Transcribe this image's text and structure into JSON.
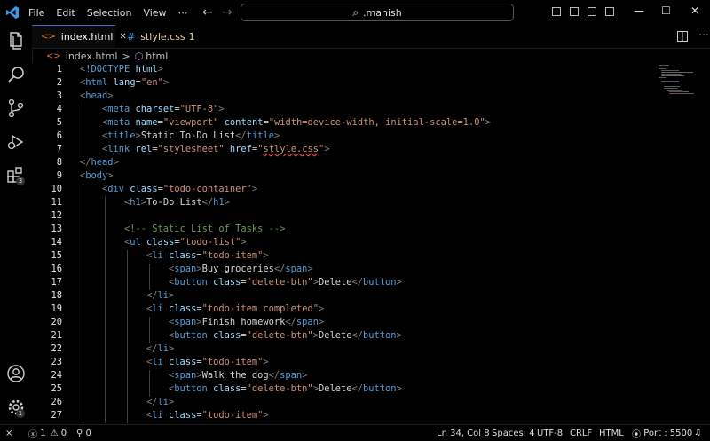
{
  "menu": [
    "File",
    "Edit",
    "Selection",
    "View",
    "⋯"
  ],
  "search": {
    "text": ".manish"
  },
  "window_controls": {
    "minimize": "—",
    "maximize": "☐",
    "close": "✕"
  },
  "activity_badges": {
    "extensions": "3",
    "settings": "1"
  },
  "tabs": [
    {
      "icon": "<>",
      "label": "index.html",
      "close": "✕",
      "active": true
    },
    {
      "icon": "#",
      "label": "stlyle.css",
      "count": "1",
      "active": false
    }
  ],
  "breadcrumb": {
    "file_icon": "<>",
    "file": "index.html",
    "sep": ">",
    "element_icon": "⬡",
    "element": "html"
  },
  "editor_lines": [
    {
      "n": "1",
      "indent": 0,
      "tokens": [
        [
          "p",
          "<"
        ],
        [
          "t",
          "!DOCTYPE "
        ],
        [
          "a",
          "html"
        ],
        [
          "p",
          ">"
        ]
      ]
    },
    {
      "n": "2",
      "indent": 0,
      "tokens": [
        [
          "p",
          "<"
        ],
        [
          "t",
          "html "
        ],
        [
          "a",
          "lang"
        ],
        [
          "x",
          "="
        ],
        [
          "s",
          "\"en\""
        ],
        [
          "p",
          ">"
        ]
      ]
    },
    {
      "n": "3",
      "indent": 0,
      "tokens": [
        [
          "p",
          "<"
        ],
        [
          "t",
          "head"
        ],
        [
          "p",
          ">"
        ]
      ]
    },
    {
      "n": "4",
      "indent": 1,
      "tokens": [
        [
          "p",
          "<"
        ],
        [
          "t",
          "meta "
        ],
        [
          "a",
          "charset"
        ],
        [
          "x",
          "="
        ],
        [
          "s",
          "\"UTF-8\""
        ],
        [
          "p",
          ">"
        ]
      ]
    },
    {
      "n": "5",
      "indent": 1,
      "tokens": [
        [
          "p",
          "<"
        ],
        [
          "t",
          "meta "
        ],
        [
          "a",
          "name"
        ],
        [
          "x",
          "="
        ],
        [
          "s",
          "\"viewport\" "
        ],
        [
          "a",
          "content"
        ],
        [
          "x",
          "="
        ],
        [
          "s",
          "\"width=device-width, initial-scale=1.0\""
        ],
        [
          "p",
          ">"
        ]
      ]
    },
    {
      "n": "6",
      "indent": 1,
      "tokens": [
        [
          "p",
          "<"
        ],
        [
          "t",
          "title"
        ],
        [
          "p",
          ">"
        ],
        [
          "x",
          "Static To-Do List"
        ],
        [
          "p",
          "</"
        ],
        [
          "t",
          "title"
        ],
        [
          "p",
          ">"
        ]
      ]
    },
    {
      "n": "7",
      "indent": 1,
      "tokens": [
        [
          "p",
          "<"
        ],
        [
          "t",
          "link "
        ],
        [
          "a",
          "rel"
        ],
        [
          "x",
          "="
        ],
        [
          "s",
          "\"stylesheet\" "
        ],
        [
          "a",
          "href"
        ],
        [
          "x",
          "="
        ],
        [
          "s",
          "\""
        ],
        [
          "su",
          "stlyle.css"
        ],
        [
          "s",
          "\""
        ],
        [
          "p",
          ">"
        ]
      ]
    },
    {
      "n": "8",
      "indent": 0,
      "tokens": [
        [
          "p",
          "</"
        ],
        [
          "t",
          "head"
        ],
        [
          "p",
          ">"
        ]
      ]
    },
    {
      "n": "9",
      "indent": 0,
      "tokens": [
        [
          "p",
          "<"
        ],
        [
          "t",
          "body"
        ],
        [
          "p",
          ">"
        ]
      ]
    },
    {
      "n": "10",
      "indent": 1,
      "tokens": [
        [
          "p",
          "<"
        ],
        [
          "t",
          "div "
        ],
        [
          "a",
          "class"
        ],
        [
          "x",
          "="
        ],
        [
          "s",
          "\"todo-container\""
        ],
        [
          "p",
          ">"
        ]
      ]
    },
    {
      "n": "11",
      "indent": 2,
      "tokens": [
        [
          "p",
          "<"
        ],
        [
          "t",
          "h1"
        ],
        [
          "p",
          ">"
        ],
        [
          "x",
          "To-Do List"
        ],
        [
          "p",
          "</"
        ],
        [
          "t",
          "h1"
        ],
        [
          "p",
          ">"
        ]
      ]
    },
    {
      "n": "12",
      "indent": 2,
      "tokens": []
    },
    {
      "n": "13",
      "indent": 2,
      "tokens": [
        [
          "c",
          "<!-- Static List of Tasks -->"
        ]
      ]
    },
    {
      "n": "14",
      "indent": 2,
      "tokens": [
        [
          "p",
          "<"
        ],
        [
          "t",
          "ul "
        ],
        [
          "a",
          "class"
        ],
        [
          "x",
          "="
        ],
        [
          "s",
          "\"todo-list\""
        ],
        [
          "p",
          ">"
        ]
      ]
    },
    {
      "n": "15",
      "indent": 3,
      "tokens": [
        [
          "p",
          "<"
        ],
        [
          "t",
          "li "
        ],
        [
          "a",
          "class"
        ],
        [
          "x",
          "="
        ],
        [
          "s",
          "\"todo-item\""
        ],
        [
          "p",
          ">"
        ]
      ]
    },
    {
      "n": "16",
      "indent": 4,
      "tokens": [
        [
          "p",
          "<"
        ],
        [
          "t",
          "span"
        ],
        [
          "p",
          ">"
        ],
        [
          "x",
          "Buy groceries"
        ],
        [
          "p",
          "</"
        ],
        [
          "t",
          "span"
        ],
        [
          "p",
          ">"
        ]
      ]
    },
    {
      "n": "17",
      "indent": 4,
      "tokens": [
        [
          "p",
          "<"
        ],
        [
          "t",
          "button "
        ],
        [
          "a",
          "class"
        ],
        [
          "x",
          "="
        ],
        [
          "s",
          "\"delete-btn\""
        ],
        [
          "p",
          ">"
        ],
        [
          "x",
          "Delete"
        ],
        [
          "p",
          "</"
        ],
        [
          "t",
          "button"
        ],
        [
          "p",
          ">"
        ]
      ]
    },
    {
      "n": "18",
      "indent": 3,
      "tokens": [
        [
          "p",
          "</"
        ],
        [
          "t",
          "li"
        ],
        [
          "p",
          ">"
        ]
      ]
    },
    {
      "n": "19",
      "indent": 3,
      "tokens": [
        [
          "p",
          "<"
        ],
        [
          "t",
          "li "
        ],
        [
          "a",
          "class"
        ],
        [
          "x",
          "="
        ],
        [
          "s",
          "\"todo-item completed\""
        ],
        [
          "p",
          ">"
        ]
      ]
    },
    {
      "n": "20",
      "indent": 4,
      "tokens": [
        [
          "p",
          "<"
        ],
        [
          "t",
          "span"
        ],
        [
          "p",
          ">"
        ],
        [
          "x",
          "Finish homework"
        ],
        [
          "p",
          "</"
        ],
        [
          "t",
          "span"
        ],
        [
          "p",
          ">"
        ]
      ]
    },
    {
      "n": "21",
      "indent": 4,
      "tokens": [
        [
          "p",
          "<"
        ],
        [
          "t",
          "button "
        ],
        [
          "a",
          "class"
        ],
        [
          "x",
          "="
        ],
        [
          "s",
          "\"delete-btn\""
        ],
        [
          "p",
          ">"
        ],
        [
          "x",
          "Delete"
        ],
        [
          "p",
          "</"
        ],
        [
          "t",
          "button"
        ],
        [
          "p",
          ">"
        ]
      ]
    },
    {
      "n": "22",
      "indent": 3,
      "tokens": [
        [
          "p",
          "</"
        ],
        [
          "t",
          "li"
        ],
        [
          "p",
          ">"
        ]
      ]
    },
    {
      "n": "23",
      "indent": 3,
      "tokens": [
        [
          "p",
          "<"
        ],
        [
          "t",
          "li "
        ],
        [
          "a",
          "class"
        ],
        [
          "x",
          "="
        ],
        [
          "s",
          "\"todo-item\""
        ],
        [
          "p",
          ">"
        ]
      ]
    },
    {
      "n": "24",
      "indent": 4,
      "tokens": [
        [
          "p",
          "<"
        ],
        [
          "t",
          "span"
        ],
        [
          "p",
          ">"
        ],
        [
          "x",
          "Walk the dog"
        ],
        [
          "p",
          "</"
        ],
        [
          "t",
          "span"
        ],
        [
          "p",
          ">"
        ]
      ]
    },
    {
      "n": "25",
      "indent": 4,
      "tokens": [
        [
          "p",
          "<"
        ],
        [
          "t",
          "button "
        ],
        [
          "a",
          "class"
        ],
        [
          "x",
          "="
        ],
        [
          "s",
          "\"delete-btn\""
        ],
        [
          "p",
          ">"
        ],
        [
          "x",
          "Delete"
        ],
        [
          "p",
          "</"
        ],
        [
          "t",
          "button"
        ],
        [
          "p",
          ">"
        ]
      ]
    },
    {
      "n": "26",
      "indent": 3,
      "tokens": [
        [
          "p",
          "</"
        ],
        [
          "t",
          "li"
        ],
        [
          "p",
          ">"
        ]
      ]
    },
    {
      "n": "27",
      "indent": 3,
      "tokens": [
        [
          "p",
          "<"
        ],
        [
          "t",
          "li "
        ],
        [
          "a",
          "class"
        ],
        [
          "x",
          "="
        ],
        [
          "s",
          "\"todo-item\""
        ],
        [
          "p",
          ">"
        ]
      ]
    }
  ],
  "status": {
    "remote": "⨯",
    "errors": "1",
    "warnings": "0",
    "ports_forwarded": "0",
    "position": "Ln 34, Col 8",
    "spaces": "Spaces: 4",
    "encoding": "UTF-8",
    "eol": "CRLF",
    "language": "HTML",
    "port": "Port : 5500",
    "bell": "🔔"
  },
  "colors": {
    "accent": "#3a6cc7",
    "tag": "#569cd6",
    "attr": "#9cdcfe",
    "string": "#ce9178",
    "comment": "#6a9955"
  }
}
